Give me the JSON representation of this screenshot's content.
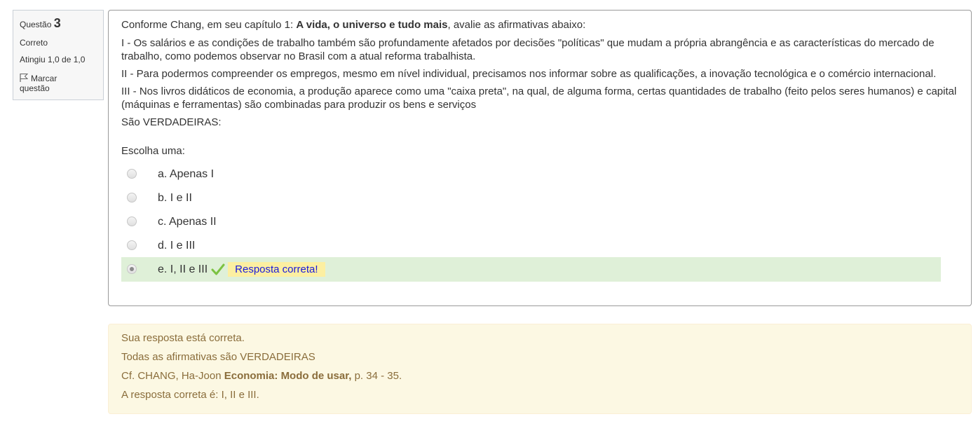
{
  "info": {
    "question_label": "Questão",
    "question_number": "3",
    "state": "Correto",
    "grade": "Atingiu 1,0 de 1,0",
    "flag_label_1": "Marcar",
    "flag_label_2": "questão"
  },
  "question": {
    "intro_prefix": "Conforme Chang, em seu capítulo 1: ",
    "intro_bold": "A vida, o universo e tudo mais",
    "intro_suffix": ", avalie as afirmativas abaixo:",
    "statements": [
      "I - Os salários e as condições de trabalho também são profundamente afetados por decisões \"políticas\" que mudam a própria abrangência e as características do mercado de trabalho, como podemos observar no Brasil com a atual reforma trabalhista.",
      "II - Para podermos compreender os empregos, mesmo em nível individual, precisamos nos informar sobre as qualificações, a inovação tecnológica e o comércio internacional.",
      "III - Nos livros didáticos de economia, a produção aparece como uma \"caixa preta\", na qual, de alguma forma, certas quantidades de trabalho (feito pelos seres humanos) e capital (máquinas e ferramentas) são combinadas para produzir os bens e serviços"
    ],
    "question_text": "São VERDADEIRAS:",
    "prompt": "Escolha uma:",
    "options": [
      {
        "label": "a. Apenas I",
        "selected": false
      },
      {
        "label": "b. I e II",
        "selected": false
      },
      {
        "label": "c. Apenas II",
        "selected": false
      },
      {
        "label": "d. I e III",
        "selected": false
      },
      {
        "label": "e. I, II e III",
        "selected": true
      }
    ],
    "correct_feedback": "Resposta correta!"
  },
  "outcome": {
    "line1": "Sua resposta está correta.",
    "line2": "Todas as afirmativas são VERDADEIRAS",
    "line3_prefix": "Cf. CHANG, Ha-Joon ",
    "line3_bold": "Economia: Modo de usar,",
    "line3_suffix": " p. 34 - 35.",
    "line4": "A resposta correta é: I, II e III."
  },
  "colors": {
    "correct_bg": "#dff0d8",
    "feedback_bg": "#fcefa1",
    "feedback_text": "#1a1adb",
    "outcome_bg": "#fcf8e3",
    "check": "#7cc242"
  },
  "icons": [
    "flag-icon",
    "check-icon"
  ]
}
